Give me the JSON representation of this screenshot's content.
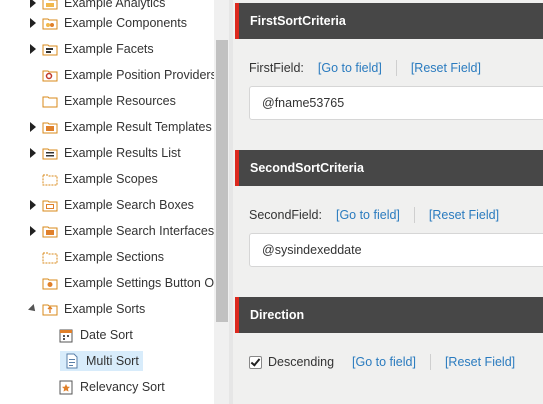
{
  "tree": {
    "items": [
      {
        "label": "Example Analytics",
        "expander": "collapsed"
      },
      {
        "label": "Example Components",
        "expander": "collapsed"
      },
      {
        "label": "Example Facets",
        "expander": "collapsed"
      },
      {
        "label": "Example Position Providers",
        "expander": "none"
      },
      {
        "label": "Example Resources",
        "expander": "none"
      },
      {
        "label": "Example Result Templates",
        "expander": "collapsed"
      },
      {
        "label": "Example Results List",
        "expander": "collapsed"
      },
      {
        "label": "Example Scopes",
        "expander": "none"
      },
      {
        "label": "Example Search Boxes",
        "expander": "collapsed"
      },
      {
        "label": "Example Search Interfaces",
        "expander": "collapsed"
      },
      {
        "label": "Example Sections",
        "expander": "none"
      },
      {
        "label": "Example Settings Button Options",
        "expander": "none"
      },
      {
        "label": "Example Sorts",
        "expander": "expanded"
      },
      {
        "label": "Date Sort",
        "child": true
      },
      {
        "label": "Multi Sort",
        "child": true,
        "selected": true
      },
      {
        "label": "Relevancy Sort",
        "child": true
      }
    ]
  },
  "sections": {
    "first": {
      "title": "FirstSortCriteria",
      "field_label": "FirstField:",
      "goto_label": "[Go to field]",
      "reset_label": "[Reset Field]",
      "value": "@fname53765"
    },
    "second": {
      "title": "SecondSortCriteria",
      "field_label": "SecondField:",
      "goto_label": "[Go to field]",
      "reset_label": "[Reset Field]",
      "value": "@sysindexeddate"
    },
    "direction": {
      "title": "Direction",
      "checkbox_label": "Descending",
      "checked": true,
      "goto_label": "[Go to field]",
      "reset_label": "[Reset Field]"
    }
  },
  "colors": {
    "header_bg": "#474747",
    "header_accent": "#dc291e",
    "link": "#2a7bbf",
    "selected_bg": "#d8ecfb"
  }
}
